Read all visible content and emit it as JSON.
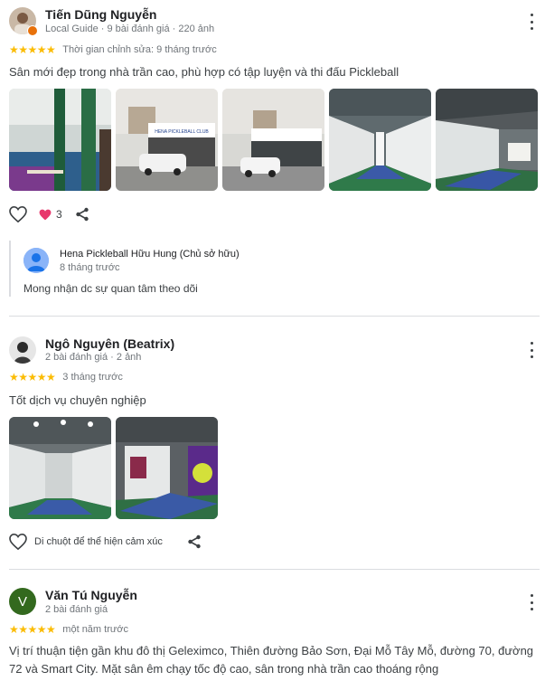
{
  "reviews": [
    {
      "name": "Tiến Dũng Nguyễn",
      "meta": "Local Guide · 9 bài đánh giá · 220 ảnh",
      "stars": "★★★★★",
      "time": "Thời gian chỉnh sửa: 9 tháng trước",
      "text": "Sân mới đẹp trong nhà trần cao, phù hợp có tập luyện và thi đấu Pickleball",
      "like_count": "3",
      "photo_sign": "HENA PICKLEBALL CLUB",
      "owner_reply": {
        "name": "Hena Pickleball Hữu Hung (Chủ sở hữu)",
        "time": "8 tháng trước",
        "text": "Mong nhận dc sự quan tâm theo dõi"
      }
    },
    {
      "name": "Ngô Nguyên (Beatrix)",
      "meta": "2 bài đánh giá · 2 ảnh",
      "stars": "★★★★★",
      "time": "3 tháng trước",
      "text": "Tốt dịch vụ chuyên nghiệp",
      "react_hint": "Di chuột để thể hiện cảm xúc"
    },
    {
      "name": "Văn Tú Nguyễn",
      "avatar_letter": "V",
      "meta": "2 bài đánh giá",
      "stars": "★★★★★",
      "time": "một năm trước",
      "text": "Vị trí thuận tiện gần khu đô thị Geleximco, Thiên đường Bảo Sơn, Đại Mỗ Tây Mỗ, đường 70, đường 72 và Smart City. Mặt sân êm chạy tốc độ cao, sân trong nhà trần cao thoáng rộng"
    }
  ]
}
